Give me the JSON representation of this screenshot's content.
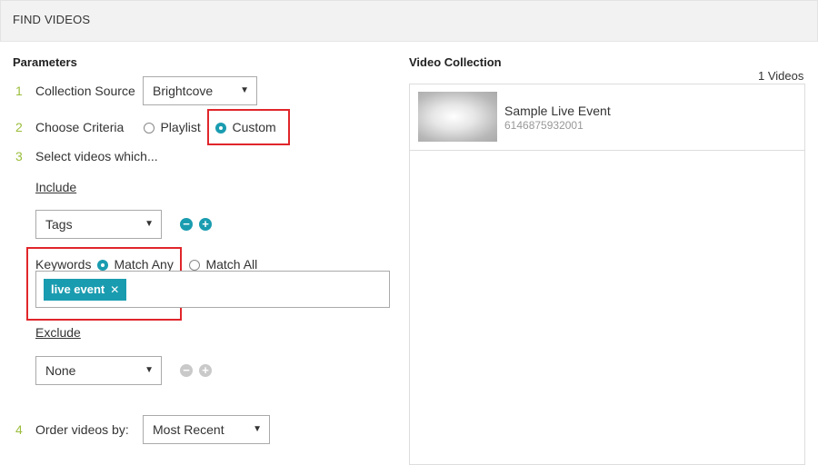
{
  "header": {
    "title": "FIND VIDEOS"
  },
  "parameters": {
    "title": "Parameters",
    "collection_source": {
      "num": "1",
      "label": "Collection Source",
      "value": "Brightcove"
    },
    "choose_criteria": {
      "num": "2",
      "label": "Choose Criteria",
      "options": [
        {
          "label": "Playlist",
          "selected": false
        },
        {
          "label": "Custom",
          "selected": true
        }
      ]
    },
    "select_videos": {
      "num": "3",
      "label": "Select videos which..."
    },
    "include": {
      "label": "Include",
      "field": "Tags",
      "keywords_label": "Keywords",
      "match_any": "Match Any",
      "match_all": "Match All",
      "match_selected": "any",
      "tags": [
        "live event"
      ]
    },
    "exclude": {
      "label": "Exclude",
      "field": "None"
    },
    "order": {
      "num": "4",
      "label": "Order videos by:",
      "value": "Most Recent"
    }
  },
  "collection": {
    "title": "Video Collection",
    "count_label": "1 Videos",
    "videos": [
      {
        "title": "Sample Live Event",
        "id": "6146875932001"
      }
    ]
  },
  "icons": {
    "minus": "minus-circle-icon",
    "plus": "plus-circle-icon",
    "dropdown": "chevron-down-icon",
    "remove_tag": "close-icon"
  },
  "colors": {
    "accent": "#1a9cb0",
    "step_number": "#9bbd3c",
    "highlight": "#e0262b",
    "disabled": "#c9c9c9"
  }
}
